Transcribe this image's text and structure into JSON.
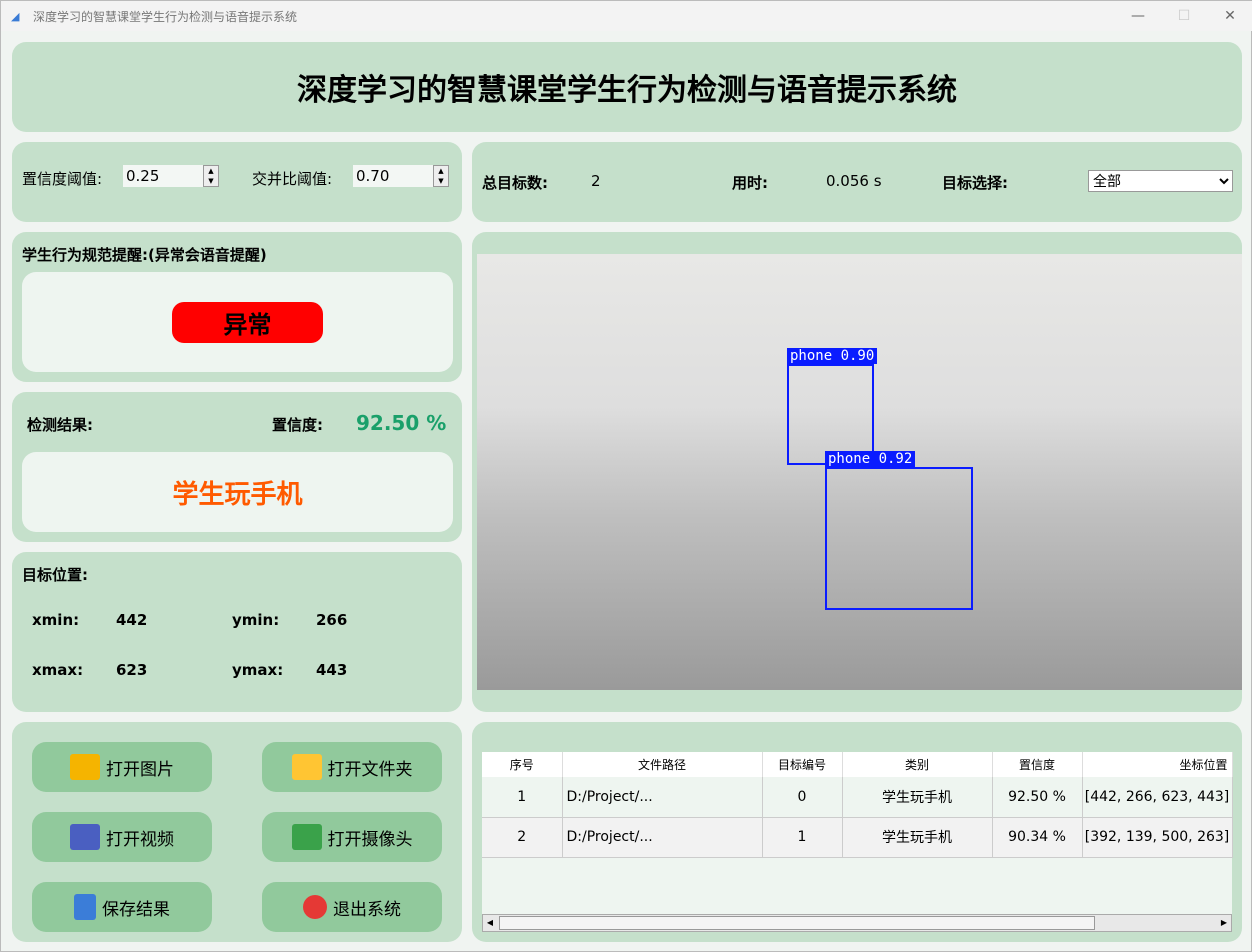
{
  "window": {
    "title": "深度学习的智慧课堂学生行为检测与语音提示系统",
    "min": "—",
    "max": "☐",
    "close": "✕"
  },
  "header": {
    "title": "深度学习的智慧课堂学生行为检测与语音提示系统"
  },
  "params": {
    "conf_label": "置信度阈值:",
    "conf_value": "0.25",
    "iou_label": "交并比阈值:",
    "iou_value": "0.70"
  },
  "stats": {
    "total_label": "总目标数:",
    "total_value": "2",
    "time_label": "用时:",
    "time_value": "0.056 s",
    "select_label": "目标选择:",
    "select_value": "全部"
  },
  "alert": {
    "title": "学生行为规范提醒:(异常会语音提醒)",
    "status": "异常",
    "status_color": "#ff0000"
  },
  "result": {
    "label": "检测结果:",
    "conf_label": "置信度:",
    "conf_value": "92.50 %",
    "class": "学生玩手机"
  },
  "position": {
    "title": "目标位置:",
    "xmin_label": "xmin:",
    "xmin": "442",
    "ymin_label": "ymin:",
    "ymin": "266",
    "xmax_label": "xmax:",
    "xmax": "623",
    "ymax_label": "ymax:",
    "ymax": "443"
  },
  "buttons": {
    "open_image": "打开图片",
    "open_folder": "打开文件夹",
    "open_video": "打开视频",
    "open_camera": "打开摄像头",
    "save": "保存结果",
    "exit": "退出系统"
  },
  "detections": [
    {
      "label": "phone 0.90"
    },
    {
      "label": "phone 0.92"
    }
  ],
  "table": {
    "headers": [
      "序号",
      "文件路径",
      "目标编号",
      "类别",
      "置信度",
      "坐标位置"
    ],
    "rows": [
      [
        "1",
        "D:/Project/...",
        "0",
        "学生玩手机",
        "92.50 %",
        "[442, 266, 623, 443]"
      ],
      [
        "2",
        "D:/Project/...",
        "1",
        "学生玩手机",
        "90.34 %",
        "[392, 139, 500, 263]"
      ]
    ]
  }
}
